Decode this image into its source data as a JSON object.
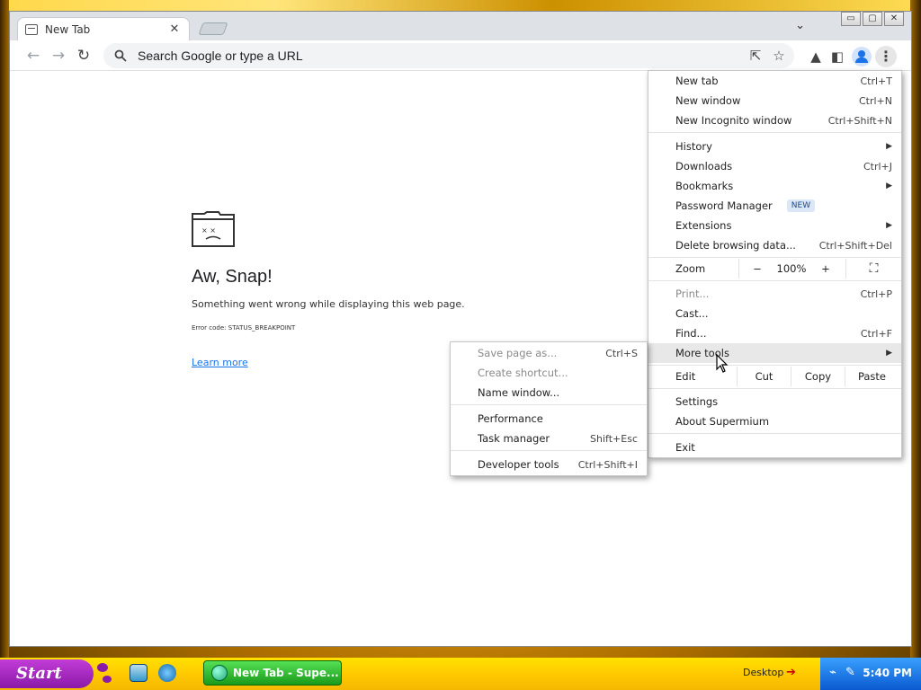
{
  "browser": {
    "tab": {
      "title": "New Tab",
      "close_glyph": "✕"
    },
    "omnibox": {
      "placeholder": "Search Google or type a URL"
    },
    "nav": {
      "back": "←",
      "forward": "→",
      "reload": "↻"
    },
    "caption": {
      "minimize": "▭",
      "maximize": "▢",
      "close": "✕"
    },
    "chevron": "⌄"
  },
  "error_page": {
    "title": "Aw, Snap!",
    "message": "Something went wrong while displaying this web page.",
    "error_code": "Error code: STATUS_BREAKPOINT",
    "learn_more": "Learn more"
  },
  "main_menu": {
    "items": [
      {
        "label": "New tab",
        "shortcut": "Ctrl+T"
      },
      {
        "label": "New window",
        "shortcut": "Ctrl+N"
      },
      {
        "label": "New Incognito window",
        "shortcut": "Ctrl+Shift+N"
      },
      {
        "label": "History",
        "arrow": "▶"
      },
      {
        "label": "Downloads",
        "shortcut": "Ctrl+J"
      },
      {
        "label": "Bookmarks",
        "arrow": "▶"
      },
      {
        "label": "Password Manager",
        "badge": "NEW"
      },
      {
        "label": "Extensions",
        "arrow": "▶"
      },
      {
        "label": "Delete browsing data...",
        "shortcut": "Ctrl+Shift+Del"
      },
      {
        "label": "Print...",
        "shortcut": "Ctrl+P"
      },
      {
        "label": "Cast..."
      },
      {
        "label": "Find...",
        "shortcut": "Ctrl+F"
      },
      {
        "label": "More tools",
        "arrow": "▶"
      },
      {
        "label": "Settings"
      },
      {
        "label": "About Supermium"
      },
      {
        "label": "Exit"
      }
    ],
    "zoom": {
      "label": "Zoom",
      "minus": "−",
      "value": "100%",
      "plus": "+",
      "fullscreen": "⛶"
    },
    "edit": {
      "label": "Edit",
      "cut": "Cut",
      "copy": "Copy",
      "paste": "Paste"
    }
  },
  "more_tools_menu": {
    "items": [
      {
        "label": "Save page as...",
        "shortcut": "Ctrl+S"
      },
      {
        "label": "Create shortcut..."
      },
      {
        "label": "Name window..."
      },
      {
        "label": "Performance"
      },
      {
        "label": "Task manager",
        "shortcut": "Shift+Esc"
      },
      {
        "label": "Developer tools",
        "shortcut": "Ctrl+Shift+I"
      }
    ]
  },
  "taskbar": {
    "start_label": "Start",
    "task_label": "New Tab - Supe...",
    "desktop_label": "Desktop",
    "desktop_arrow": "➔",
    "clock": "5:40 PM"
  }
}
